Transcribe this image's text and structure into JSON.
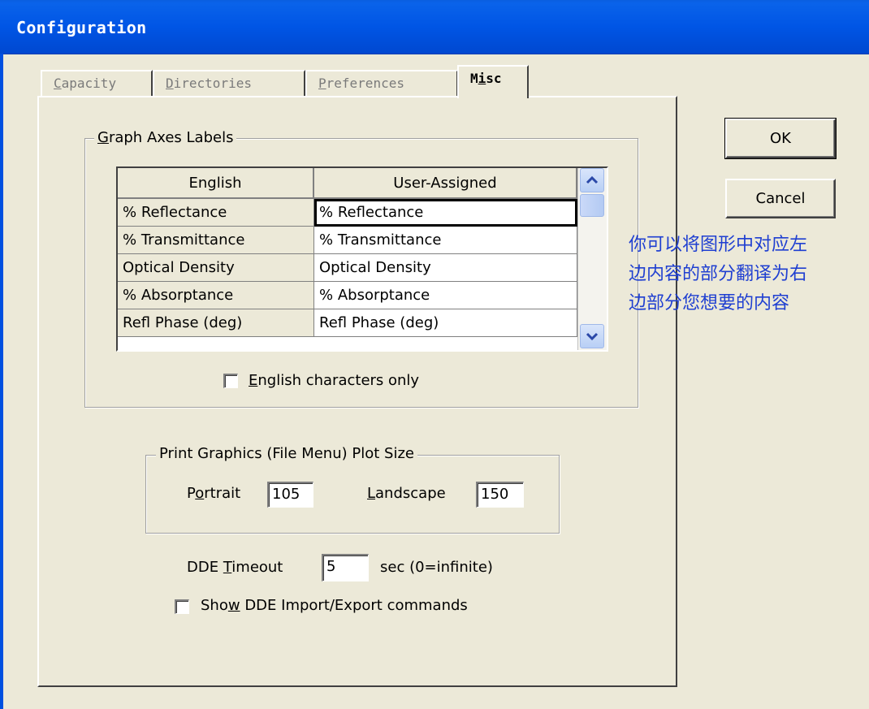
{
  "window": {
    "title": "Configuration"
  },
  "tabs": [
    {
      "label": "Capacity",
      "underline_index": 0
    },
    {
      "label": "Directories",
      "underline_index": 0
    },
    {
      "label": "Preferences",
      "underline_index": 0
    },
    {
      "label": "Misc",
      "underline_index": 1,
      "active": true
    }
  ],
  "graph_axes": {
    "group_label_pre": "",
    "group_label_u": "G",
    "group_label_post": "raph Axes Labels",
    "columns": [
      "English",
      "User-Assigned"
    ],
    "rows": [
      {
        "english": "% Reflectance",
        "user": "% Reflectance"
      },
      {
        "english": "% Transmittance",
        "user": "% Transmittance"
      },
      {
        "english": "Optical Density",
        "user": "Optical Density"
      },
      {
        "english": "% Absorptance",
        "user": "% Absorptance"
      },
      {
        "english": "Refl Phase (deg)",
        "user": "Refl Phase (deg)"
      }
    ],
    "english_only_u": "E",
    "english_only_rest": "nglish characters only",
    "english_only_checked": false
  },
  "print_graphics": {
    "group_label": "Print Graphics (File Menu) Plot Size",
    "portrait_pre": "P",
    "portrait_u": "o",
    "portrait_post": "rtrait",
    "portrait_value": "105",
    "landscape_u": "L",
    "landscape_post": "andscape",
    "landscape_value": "150"
  },
  "dde": {
    "timeout_pre": "DDE ",
    "timeout_u": "T",
    "timeout_post": "imeout",
    "timeout_value": "5",
    "timeout_unit": "sec (0=infinite)",
    "show_pre": "Sho",
    "show_u": "w",
    "show_post": " DDE Import/Export commands",
    "show_checked": false
  },
  "buttons": {
    "ok": "OK",
    "cancel": "Cancel"
  },
  "annotation": {
    "line1": "你可以将图形中对应左",
    "line2": "边内容的部分翻译为右",
    "line3": "边部分您想要的内容",
    "color": "#1f3fd1"
  }
}
